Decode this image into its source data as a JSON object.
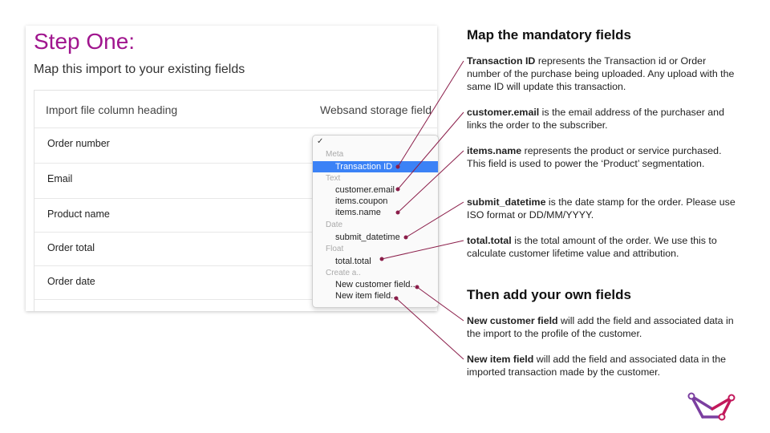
{
  "panel": {
    "title": "Step One:",
    "subtitle": "Map this import to your existing fields",
    "col_left": "Import file column heading",
    "col_right": "Websand storage field",
    "rows": [
      "Order number",
      "Email",
      "Product name",
      "Order total",
      "Order date"
    ]
  },
  "menu": {
    "check": "✓",
    "groups": {
      "meta": "Meta",
      "text": "Text",
      "date": "Date",
      "float": "Float",
      "create": "Create a.."
    },
    "options": {
      "transaction_id": "Transaction ID",
      "customer_email": "customer.email",
      "items_coupon": "items.coupon",
      "items_name": "items.name",
      "submit_datetime": "submit_datetime",
      "total_total": "total.total",
      "new_customer_field": "New customer field..",
      "new_item_field": "New item field.."
    },
    "selected": "Transaction ID"
  },
  "annotations": {
    "heading_mandatory": "Map the mandatory fields",
    "heading_own": "Then add your own fields",
    "notes": [
      {
        "term": "Transaction ID",
        "text": " represents the Transaction id or Order number of the purchase being uploaded.  Any upload with the same ID will update this transaction."
      },
      {
        "term": "customer.email",
        "text": " is the email address of the purchaser and links the order to the subscriber."
      },
      {
        "term": "items.name",
        "text": " represents the product or service purchased.  This field is used to power the ‘Product’ segmentation."
      },
      {
        "term": "submit_datetime",
        "text": " is the date stamp for the order. Please use ISO format or DD/MM/YYYY."
      },
      {
        "term": "total.total",
        "text": " is the total amount of the order. We use this to calculate customer lifetime value and attribution."
      },
      {
        "term": "New customer field",
        "text": " will add the field and associated data in the import to the profile of the customer."
      },
      {
        "term": "New item field",
        "text": " will add the field and associated data in the imported transaction made by the customer."
      }
    ]
  },
  "colors": {
    "title": "#a0158e",
    "selection": "#3b82f6",
    "connector": "#8b1e4a",
    "logo_purple": "#7b3fa0",
    "logo_pink": "#c2185b"
  }
}
